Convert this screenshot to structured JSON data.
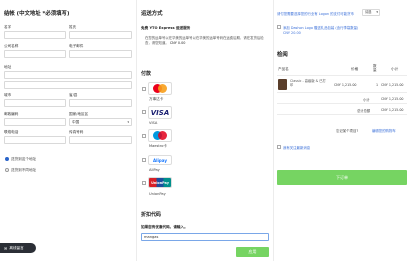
{
  "billing": {
    "title": "结帐 (中文地址 *必须填写)",
    "fields": {
      "first_name": "名字",
      "last_name": "姓氏",
      "company": "公司名称",
      "email": "电子邮件",
      "address": "地址",
      "city": "城市",
      "province": "省/县",
      "postcode": "邮政编码",
      "country": "国家/地区区",
      "country_value": "中国",
      "phone": "联络电话",
      "fax": "传真号码"
    },
    "shipping_options": [
      {
        "label": "送货到这个地址",
        "selected": true
      },
      {
        "label": "送货到不同地址",
        "selected": false
      }
    ]
  },
  "shipping": {
    "title": "运送方式",
    "method_title": "免费 YTO Express 运送服务",
    "method_desc": "在您的运单号以在华美的运单号以在华美的运单号码在运费后期，请在发货后检查，请您知道。",
    "price": "CNY 0.00",
    "payment_title": "付款",
    "payment_methods": [
      {
        "name": "万事达卡",
        "logo": "MasterCard",
        "icon": "mastercard-icon"
      },
      {
        "name": "VISA",
        "logo": "VISA",
        "icon": "visa-icon"
      },
      {
        "name": "Maestro卡",
        "logo": "Maestro",
        "icon": "maestro-icon"
      },
      {
        "name": "AliPay",
        "logo": "Alipay",
        "icon": "alipay-icon"
      },
      {
        "name": "UnionPay",
        "logo": "UnionPay",
        "icon": "unionpay-icon"
      }
    ],
    "discount_title": "折扣代码",
    "discount_prompt": "如果您有优惠代码，请输入。",
    "discount_value": "mangas",
    "apply_label": "应用"
  },
  "review": {
    "currency_note": "请付您需要选择您的行业有 Logon 的支付可能货币",
    "currency_select": "请选",
    "gift_note": "添加 Dashon Logo 赠送礼品包装 (含行李袋数量)",
    "gift_price": "CNY 20.00",
    "title": "检阅",
    "headers": {
      "product": "产品名",
      "price": "价格",
      "qty": "数量",
      "subtotal": "小计"
    },
    "items": [
      {
        "name": "Classic - 高级版 & 已打印",
        "price": "CNY 1,215.00",
        "qty": "1",
        "subtotal": "CNY 1,215.00"
      }
    ],
    "subtotal_label": "小计",
    "subtotal_value": "CNY 1,215.00",
    "total_label": "总计总额",
    "total_value": "CNY 1,215.00",
    "forgot_label": "忘记某个项目?",
    "edit_cart_link": "编辑您的购物车",
    "newsletter": "我有关注最新消息",
    "place_order": "下订单"
  },
  "chat": {
    "label": "离线留言"
  }
}
